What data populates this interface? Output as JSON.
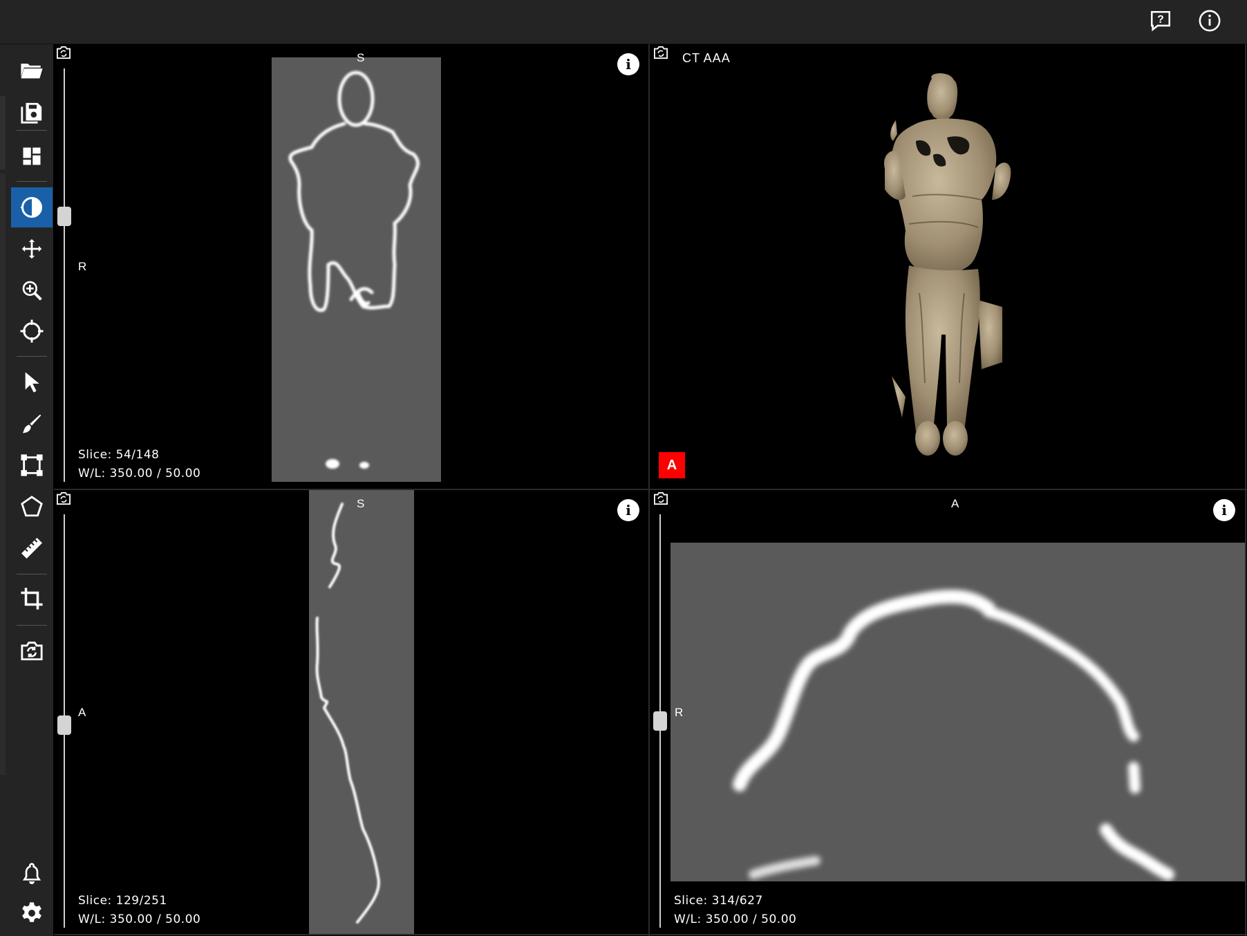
{
  "topbar": {
    "icons": [
      "help-feedback-icon",
      "info-icon"
    ]
  },
  "sidebar": {
    "tools": [
      "open-folder-icon",
      "save-icon",
      "layout-icon",
      "contrast-icon",
      "pan-icon",
      "zoom-icon",
      "crosshair-icon",
      "select-icon",
      "brush-icon",
      "rectangle-roi-icon",
      "polygon-icon",
      "ruler-icon",
      "crop-icon",
      "screenshot-icon"
    ],
    "bottom": [
      "notifications-icon",
      "settings-icon"
    ]
  },
  "viewports": {
    "coronal": {
      "orient_top": "S",
      "orient_left": "R",
      "slice": "Slice: 54/148",
      "wl": "W/L: 350.00 / 50.00",
      "slider_position": 0.35
    },
    "volume": {
      "title": "CT AAA",
      "badge": "A"
    },
    "sagittal": {
      "orient_top": "S",
      "orient_left": "A",
      "slice": "Slice: 129/251",
      "wl": "W/L: 350.00 / 50.00",
      "slider_position": 0.51
    },
    "axial": {
      "orient_top": "A",
      "orient_left": "R",
      "slice": "Slice: 314/627",
      "wl": "W/L: 350.00 / 50.00",
      "slider_position": 0.5
    }
  },
  "colors": {
    "accent": "#1a60a8",
    "badge": "#ff0000",
    "panel": "#242424",
    "image_gray": "#5a5a5a"
  }
}
